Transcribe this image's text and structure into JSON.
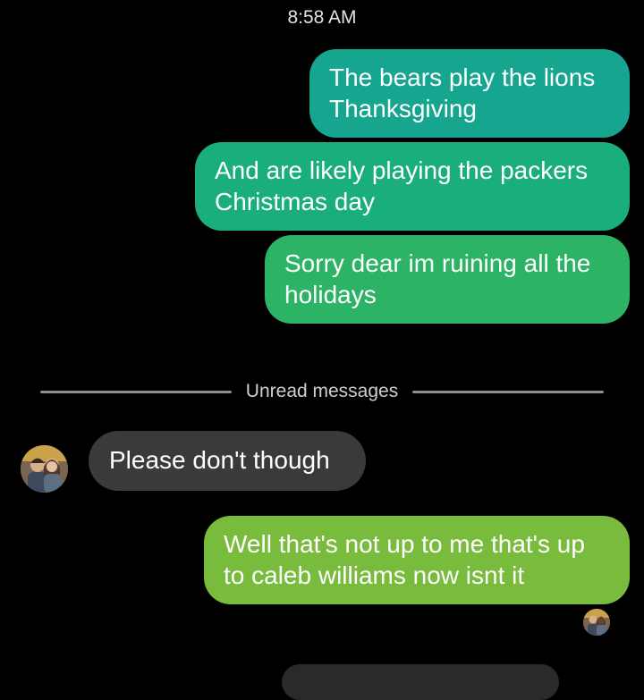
{
  "conversation": {
    "timestamp": "8:58 AM",
    "messages": [
      {
        "direction": "sent",
        "text": "The bears play the lions\nThanksgiving",
        "color": "#16a58f"
      },
      {
        "direction": "sent",
        "text": "And are likely playing the packers\nChristmas day",
        "color": "#1aaf7a"
      },
      {
        "direction": "sent",
        "text": "Sorry dear im ruining all the\nholidays",
        "color": "#2cb366"
      },
      {
        "direction": "received",
        "text": "Please don't though",
        "color": "#3a3a3a"
      },
      {
        "direction": "sent",
        "text": "Well that's not up to me that's up\nto caleb williams now isnt it",
        "color": "#79bb3c"
      }
    ],
    "unread_divider": "Unread messages"
  },
  "avatars": {
    "contact": "contact-avatar-photo",
    "read_receipt": "read-receipt-avatar-photo"
  }
}
